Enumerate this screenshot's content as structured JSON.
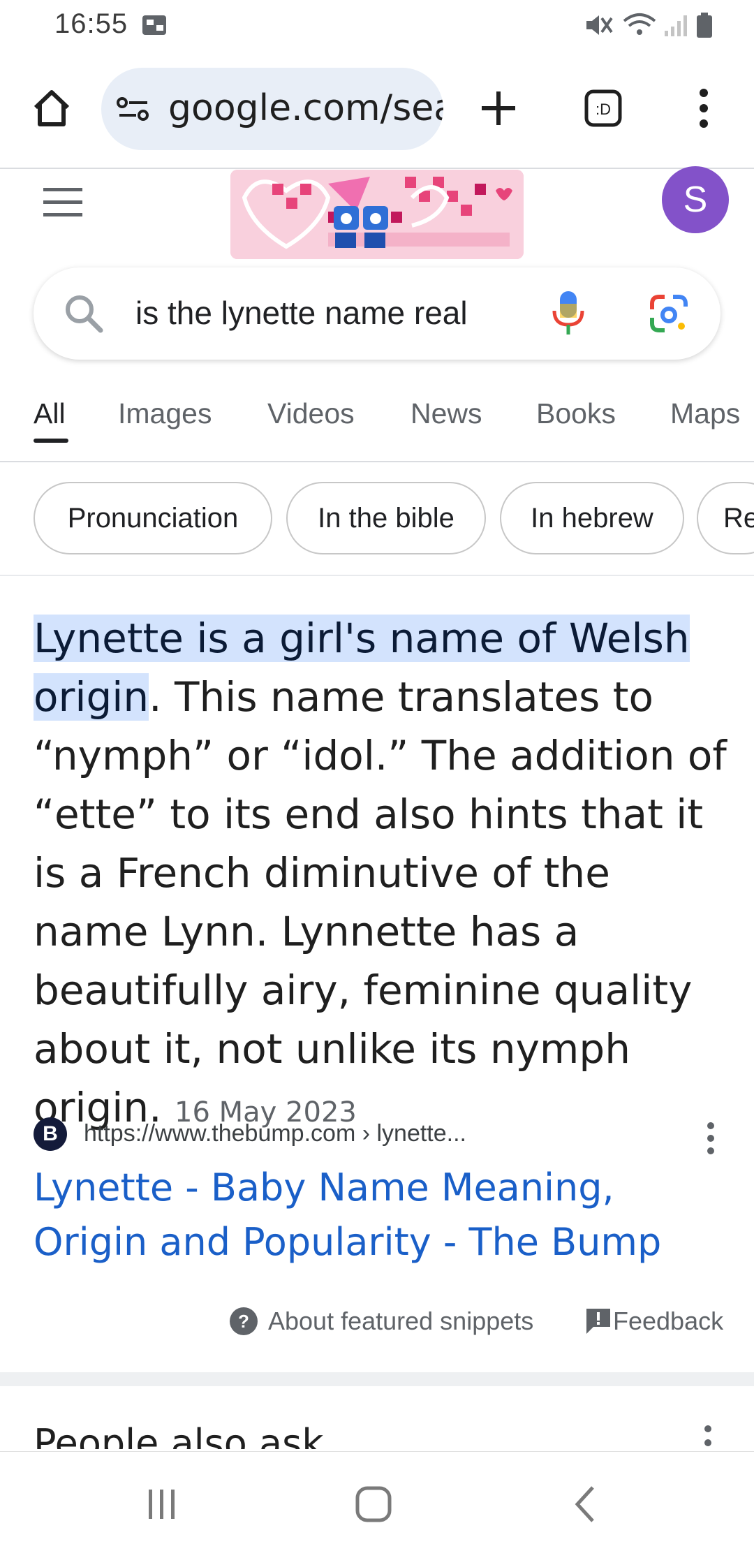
{
  "status_bar": {
    "time": "16:55"
  },
  "browser": {
    "url": "google.com/search",
    "icons": [
      "home-icon",
      "site-info-icon",
      "new-tab-icon",
      "tab-switcher-icon",
      "more-vert-icon"
    ]
  },
  "google": {
    "avatar_letter": "S",
    "search_query": "is the lynette name real",
    "tabs": [
      "All",
      "Images",
      "Videos",
      "News",
      "Books",
      "Maps"
    ],
    "active_tab": "All",
    "chips": [
      "Pronunciation",
      "In the bible",
      "In hebrew",
      "Re"
    ]
  },
  "snippet": {
    "highlight": "Lynette is a girl's name of Welsh origin",
    "body": ". This name translates to “nymph” or “idol.” The addition of “ette” to its end also hints that it is a French diminutive of the name Lynn. Lynnette has a beautifully airy, feminine quality about it, not unlike its nymph origin.",
    "date": "16 May 2023"
  },
  "source": {
    "logo_letter": "B",
    "url": "https://www.thebump.com › lynette...",
    "title": "Lynette - Baby Name Meaning, Origin and Popularity - The Bump"
  },
  "footer_links": {
    "about": "About featured snippets",
    "feedback": "Feedback"
  },
  "next_section": {
    "title": "People also ask"
  },
  "colors": {
    "link_blue": "#1a5fc8",
    "highlight": "#d3e3fd",
    "avatar": "#8352c9",
    "url_box": "#e8eef7"
  }
}
